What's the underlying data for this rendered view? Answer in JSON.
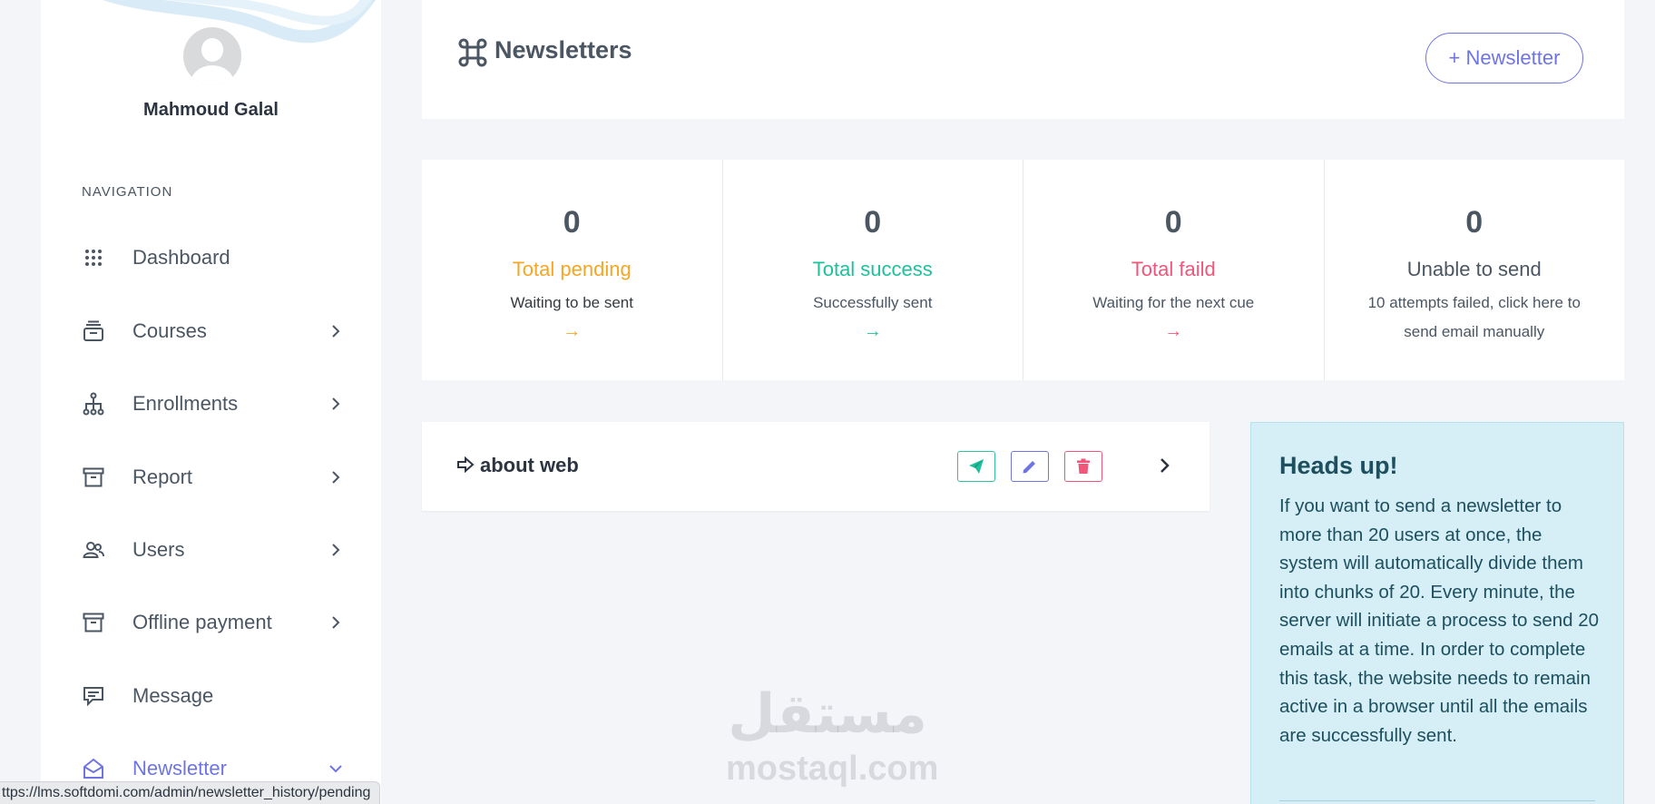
{
  "sidebar": {
    "user_name": "Mahmoud Galal",
    "nav_heading": "NAVIGATION",
    "items": [
      {
        "label": "Dashboard",
        "icon": "grid-dots-icon",
        "has_chevron": false
      },
      {
        "label": "Courses",
        "icon": "stack-icon",
        "has_chevron": true
      },
      {
        "label": "Enrollments",
        "icon": "hierarchy-icon",
        "has_chevron": true
      },
      {
        "label": "Report",
        "icon": "archive-icon",
        "has_chevron": true
      },
      {
        "label": "Users",
        "icon": "users-icon",
        "has_chevron": true
      },
      {
        "label": "Offline payment",
        "icon": "archive-icon",
        "has_chevron": true
      },
      {
        "label": "Message",
        "icon": "chat-icon",
        "has_chevron": false
      },
      {
        "label": "Newsletter",
        "icon": "envelope-open-icon",
        "has_chevron": true,
        "active": true
      }
    ]
  },
  "header": {
    "title": "Newsletters",
    "add_button": "+ Newsletter"
  },
  "stats": [
    {
      "count": "0",
      "label": "Total pending",
      "desc": "Waiting to be sent",
      "arrow": "→",
      "color": "#f5a623"
    },
    {
      "count": "0",
      "label": "Total success",
      "desc": "Successfully sent",
      "arrow": "→",
      "color": "#1ec19c"
    },
    {
      "count": "0",
      "label": "Total faild",
      "desc": "Waiting for the next cue",
      "arrow": "→",
      "color": "#f0567a"
    },
    {
      "count": "0",
      "label": "Unable to send",
      "desc": "10 attempts failed, click here to send email manually",
      "arrow": "",
      "color": "#4b5663"
    }
  ],
  "newsletter_item": {
    "name": "about web"
  },
  "info": {
    "title": "Heads up!",
    "text": "If you want to send a newsletter to more than 20 users at once, the system will automatically divide them into chunks of 20. Every minute, the server will initiate a process to send 20 emails at a time. In order to complete this task, the website needs to remain active in a browser until all the emails are successfully sent."
  },
  "watermark": {
    "arabic": "مستقل",
    "latin": "mostaql.com"
  },
  "status_url": "ttps://lms.softdomi.com/admin/newsletter_history/pending",
  "colors": {
    "accent": "#6f74e3",
    "success": "#1ec19c",
    "warning": "#f5a623",
    "danger": "#f0567a",
    "info_bg": "#d6eff6"
  }
}
